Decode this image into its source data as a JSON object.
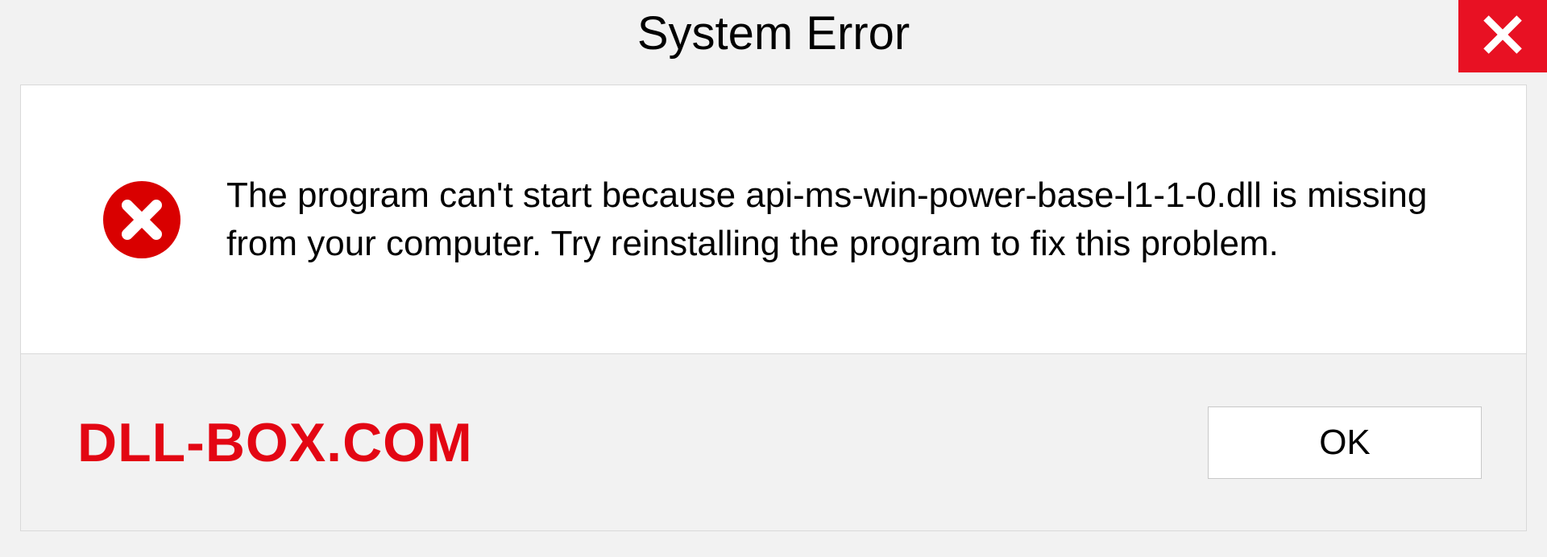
{
  "dialog": {
    "title": "System Error",
    "message": "The program can't start because api-ms-win-power-base-l1-1-0.dll is missing from your computer. Try reinstalling the program to fix this problem.",
    "ok_label": "OK"
  },
  "watermark": "DLL-BOX.COM",
  "colors": {
    "close_bg": "#e81123",
    "error_red": "#d90000",
    "watermark_red": "#e30613"
  }
}
